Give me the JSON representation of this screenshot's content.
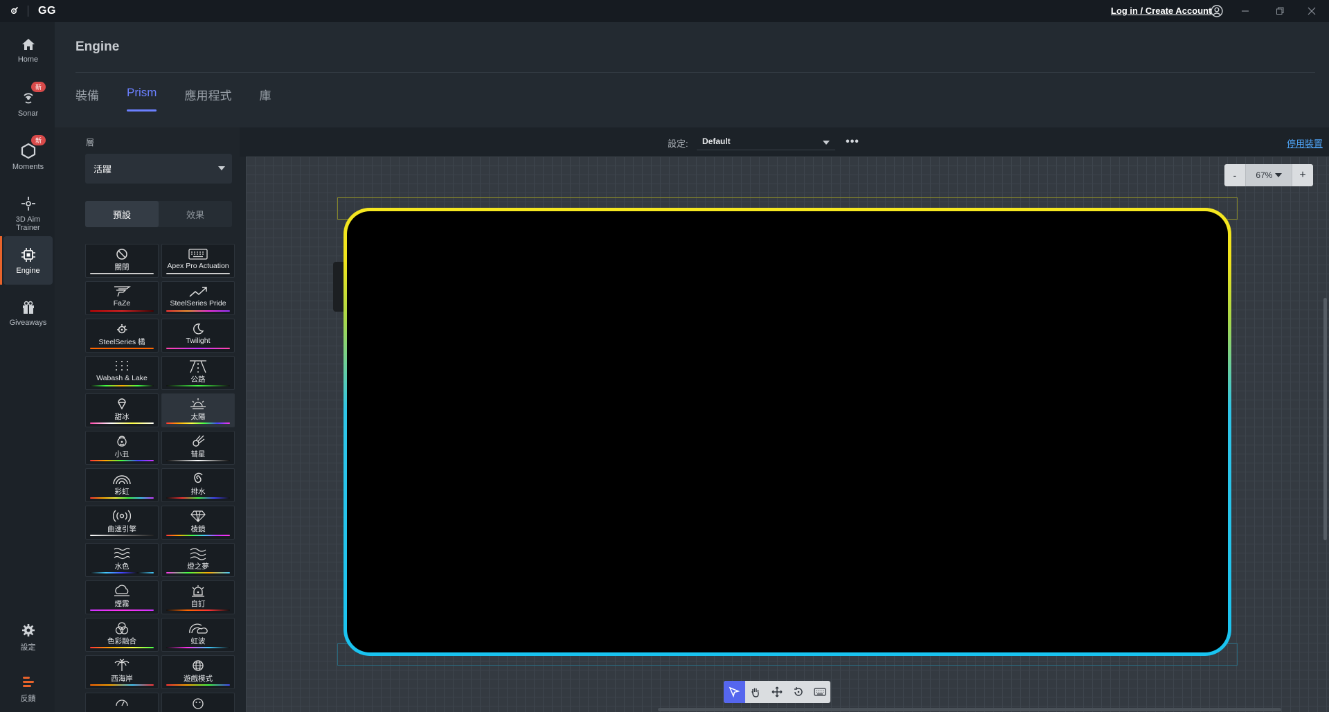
{
  "titlebar": {
    "brand": "GG",
    "login": "Log in / Create Account"
  },
  "nav": {
    "items": [
      {
        "label": "Home",
        "icon": "home-icon"
      },
      {
        "label": "Sonar",
        "icon": "sonar-icon",
        "badge": "新"
      },
      {
        "label": "Moments",
        "icon": "moments-icon",
        "badge": "新"
      },
      {
        "label": "3D Aim Trainer",
        "icon": "aim-trainer-icon"
      },
      {
        "label": "Engine",
        "icon": "engine-icon",
        "active": true
      },
      {
        "label": "Giveaways",
        "icon": "gift-icon"
      }
    ],
    "settings_label": "設定",
    "feedback_label": "反饋"
  },
  "header": {
    "title": "Engine",
    "tabs": [
      {
        "label": "裝備"
      },
      {
        "label": "Prism",
        "active": true
      },
      {
        "label": "應用程式"
      },
      {
        "label": "庫"
      }
    ]
  },
  "left_panel": {
    "layer_label": "層",
    "layer_value": "活躍",
    "subtabs": [
      {
        "label": "預設",
        "active": true
      },
      {
        "label": "效果"
      }
    ],
    "presets": [
      {
        "label": "關閉",
        "icon": "off-icon"
      },
      {
        "label": "Apex Pro Actuation",
        "icon": "keyboard-icon"
      },
      {
        "label": "FaZe",
        "icon": "faze-icon"
      },
      {
        "label": "SteelSeries Pride",
        "icon": "trend-icon"
      },
      {
        "label": "SteelSeries 橘",
        "icon": "steelseries-icon"
      },
      {
        "label": "Twilight",
        "icon": "moon-icon"
      },
      {
        "label": "Wabash & Lake",
        "icon": "dots-icon"
      },
      {
        "label": "公路",
        "icon": "road-icon"
      },
      {
        "label": "甜冰",
        "icon": "icecream-icon"
      },
      {
        "label": "太陽",
        "icon": "sunrise-icon"
      },
      {
        "label": "小丑",
        "icon": "clown-icon"
      },
      {
        "label": "彗星",
        "icon": "comet-icon"
      },
      {
        "label": "彩虹",
        "icon": "rainbow-icon"
      },
      {
        "label": "排水",
        "icon": "spiral-icon"
      },
      {
        "label": "曲速引擎",
        "icon": "signal-icon"
      },
      {
        "label": "棱鏡",
        "icon": "diamond-icon"
      },
      {
        "label": "水色",
        "icon": "waves-icon"
      },
      {
        "label": "燈之夢",
        "icon": "wavy-icon"
      },
      {
        "label": "煙霧",
        "icon": "cloud-icon"
      },
      {
        "label": "自訂",
        "icon": "alarm-icon"
      },
      {
        "label": "色彩融合",
        "icon": "colors-icon"
      },
      {
        "label": "虹波",
        "icon": "rainbow-cloud-icon"
      },
      {
        "label": "西海岸",
        "icon": "palm-icon"
      },
      {
        "label": "遊戲模式",
        "icon": "globe-icon"
      },
      {
        "label": "",
        "icon": "gauge-icon"
      },
      {
        "label": "",
        "icon": "smiley-icon"
      }
    ]
  },
  "toolbar": {
    "settings_label": "設定:",
    "settings_value": "Default",
    "disable_link": "停用裝置"
  },
  "canvas": {
    "zoom_minus": "-",
    "zoom_value": "67%",
    "zoom_plus": "+"
  }
}
